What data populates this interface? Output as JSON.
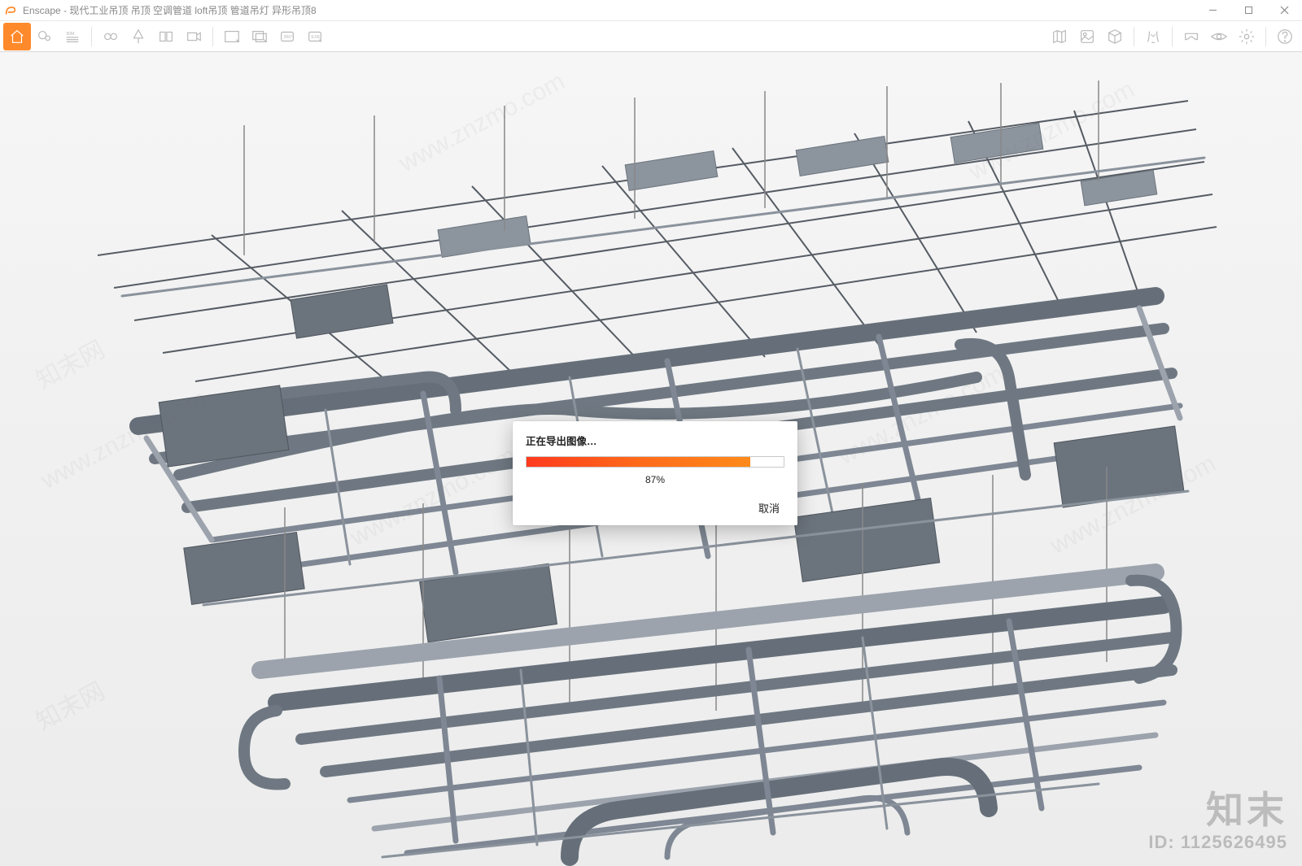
{
  "titlebar": {
    "app_name": "Enscape",
    "separator": " - ",
    "document_title": "现代工业吊顶 吊顶 空调管道 loft吊顶 管道吊灯 异形吊顶8"
  },
  "toolbar": {
    "bim_label": "BIM"
  },
  "dialog": {
    "title": "正在导出图像…",
    "progress_percent": 87,
    "progress_text": "87%",
    "cancel_label": "取消"
  },
  "watermark": {
    "brand": "知末",
    "id_label": "ID: 1125626495",
    "diag_text_a": "知末网",
    "diag_text_b": "www.znzmo.com"
  },
  "colors": {
    "accent": "#ff8a2b",
    "progress_start": "#ff3a1e",
    "progress_end": "#ff8a1a"
  }
}
